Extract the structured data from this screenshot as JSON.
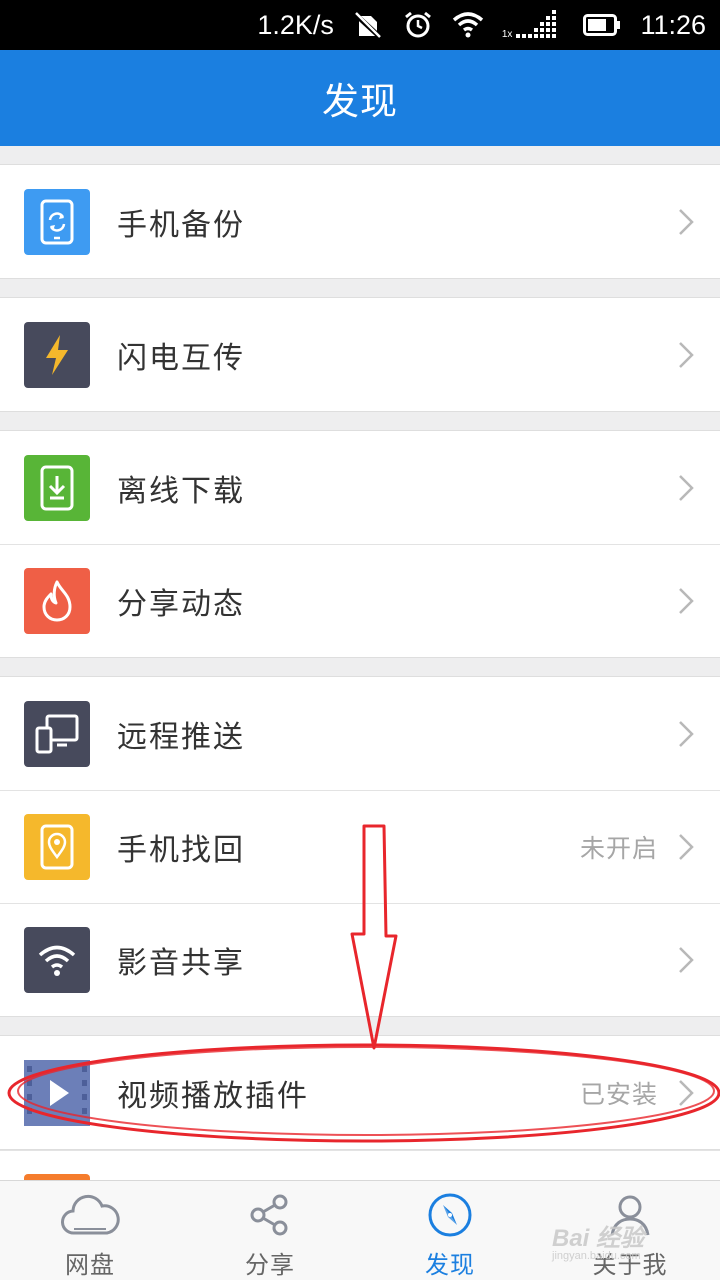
{
  "status_bar": {
    "speed": "1.2K/s",
    "signal_multiplier": "1x",
    "time": "11:26",
    "icons": [
      "no-sim-icon",
      "alarm-icon",
      "wifi-icon",
      "signal-icon",
      "battery-icon"
    ]
  },
  "header": {
    "title": "发现"
  },
  "groups": [
    [
      {
        "label": "手机备份",
        "icon": "phone-backup-icon",
        "color": "#3e9bf2",
        "status": ""
      }
    ],
    [
      {
        "label": "闪电互传",
        "icon": "lightning-icon",
        "color": "#474a5c",
        "status": ""
      }
    ],
    [
      {
        "label": "离线下载",
        "icon": "offline-download-icon",
        "color": "#58b537",
        "status": ""
      },
      {
        "label": "分享动态",
        "icon": "flame-icon",
        "color": "#ef5f46",
        "status": ""
      }
    ],
    [
      {
        "label": "远程推送",
        "icon": "remote-push-icon",
        "color": "#474a5c",
        "status": ""
      },
      {
        "label": "手机找回",
        "icon": "phone-locate-icon",
        "color": "#f5b82c",
        "status": "未开启"
      },
      {
        "label": "影音共享",
        "icon": "wifi-share-icon",
        "color": "#474a5c",
        "status": ""
      }
    ],
    [
      {
        "label": "视频播放插件",
        "icon": "video-play-icon",
        "color": "#6c7fb8",
        "status": "已安装"
      }
    ]
  ],
  "bottom_nav": [
    {
      "label": "网盘",
      "icon": "cloud-icon",
      "active": false
    },
    {
      "label": "分享",
      "icon": "share-icon",
      "active": false
    },
    {
      "label": "发现",
      "icon": "compass-icon",
      "active": true
    },
    {
      "label": "关于我",
      "icon": "person-icon",
      "active": false
    }
  ],
  "watermark": {
    "text": "Bai 经验",
    "sub": "jingyan.baidu.com"
  },
  "colors": {
    "accent": "#1b7fe0",
    "annotation": "#e8262c"
  }
}
